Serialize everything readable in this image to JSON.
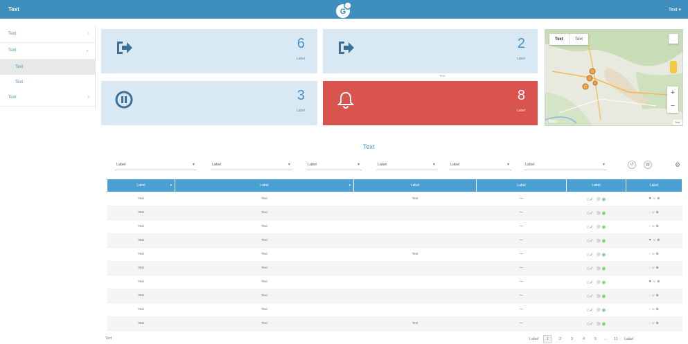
{
  "header": {
    "brand": "Text",
    "user_menu": "Text ▾",
    "colors": {
      "bar": "#3e8fc0"
    }
  },
  "sidebar": {
    "items": [
      {
        "label": "Text",
        "icon": "chevron-right-icon"
      },
      {
        "label": "Text",
        "icon": "chevron-down-icon"
      },
      {
        "label": "Text",
        "sub": true,
        "active": true
      },
      {
        "label": "Text",
        "sub": true
      },
      {
        "label": "Text",
        "icon": "chevron-right-icon"
      }
    ]
  },
  "cards": [
    {
      "value": "6",
      "label": "Label",
      "icon": "exit-icon",
      "color": "#d8e9f4"
    },
    {
      "value": "2",
      "label": "Label",
      "icon": "exit-icon",
      "color": "#d8e9f4"
    },
    {
      "value": "3",
      "label": "Label",
      "icon": "pause-icon",
      "color": "#d8e9f4"
    },
    {
      "value": "8",
      "label": "Label",
      "icon": "bell-icon",
      "color": "#d9534f"
    }
  ],
  "cards_note": "Text",
  "map": {
    "tab_map": "Text",
    "tab_satellite": "Text",
    "attribution": "Text",
    "logo": "Text"
  },
  "section_title": "Text",
  "filters": [
    {
      "value": "Label"
    },
    {
      "value": "Label"
    },
    {
      "value": "Label"
    },
    {
      "value": "Label"
    },
    {
      "value": "Label"
    },
    {
      "value": "Label"
    }
  ],
  "table": {
    "columns": [
      "Label",
      "Label",
      "Label",
      "Label",
      "Label",
      "Label"
    ],
    "rows": [
      {
        "cells": [
          "Text",
          "Text",
          "Text",
          "—"
        ],
        "a": "▼ ☺ ⊕"
      },
      {
        "cells": [
          "Text",
          "Text",
          "",
          "—"
        ],
        "a": "◦ ☺ ⊕"
      },
      {
        "cells": [
          "Text",
          "Text",
          "",
          "—"
        ],
        "a": "◦ ☺ ⊕"
      },
      {
        "cells": [
          "Text",
          "Text",
          "",
          "—"
        ],
        "a": "▼ ☺ ⊕"
      },
      {
        "cells": [
          "Text",
          "Text",
          "Text",
          "—"
        ],
        "a": "◦ ☺ ⊕"
      },
      {
        "cells": [
          "Text",
          "Text",
          "",
          "—"
        ],
        "a": "◦ ☺ ⊕"
      },
      {
        "cells": [
          "Text",
          "Text",
          "",
          "—"
        ],
        "a": "▼ ☺ ⊕"
      },
      {
        "cells": [
          "Text",
          "Text",
          "",
          "—"
        ],
        "a": "◦ ☺ ⊕"
      },
      {
        "cells": [
          "Text",
          "Text",
          "",
          "—"
        ],
        "a": "◦ ☺ ⊕"
      },
      {
        "cells": [
          "Text",
          "Text",
          "Text",
          "—"
        ],
        "a": "◦ ☺ ⊕"
      }
    ]
  },
  "footer": {
    "info": "Text",
    "prev": "Label",
    "pages": [
      "1",
      "2",
      "3",
      "4",
      "5"
    ],
    "ellipsis": "…",
    "last": "11",
    "next": "Label"
  }
}
